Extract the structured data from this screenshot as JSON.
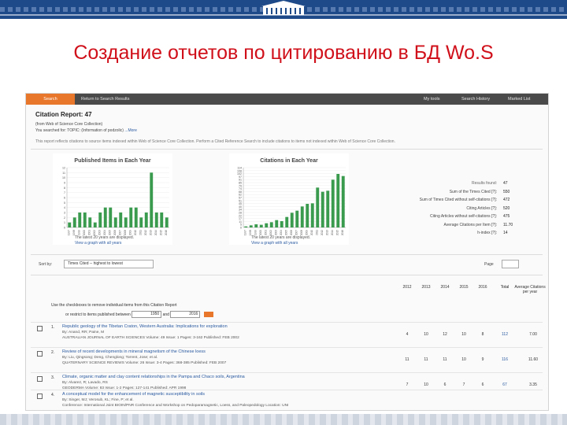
{
  "slide": {
    "title": "Создание отчетов по цитированию в БД Wo.S",
    "banner_color": "#1f4a8a",
    "title_color": "#d0101a"
  },
  "wos": {
    "accent": "#e8762b",
    "nav": {
      "search": "Search",
      "return": "Return to Search Results",
      "my_tools": "My tools",
      "search_history": "Search History",
      "marked_list": "Marked List"
    },
    "report_title": "Citation Report: 47",
    "report_lines": {
      "from": "(from Web of Science Core Collection)",
      "searched_prefix": "You searched for: TOPIC: (Information of podzolic) ",
      "more": "...More",
      "notice": "This report reflects citations to source items indexed within Web of Science Core Collection. Perform a Cited Reference Search to include citations to items not indexed within Web of Science Core Collection."
    },
    "panels": {
      "left": {
        "title": "Published Items in Each Year",
        "note1": "The latest 20 years are displayed.",
        "note2": "View a graph with all years"
      },
      "right": {
        "title": "Citations in Each Year",
        "note1": "The latest 20 years are displayed.",
        "note2": "View a graph with all years"
      }
    },
    "summary": [
      {
        "label": "Results found:",
        "value": "47"
      },
      {
        "label": "Sum of the Times Cited [?]:",
        "value": "550"
      },
      {
        "label": "Sum of Times Cited without self-citations [?]:",
        "value": "472"
      },
      {
        "label": "Citing Articles [?]:",
        "value": "520"
      },
      {
        "label": "Citing Articles without self-citations [?]:",
        "value": "475"
      },
      {
        "label": "Average Citations per Item [?]:",
        "value": "11.70"
      },
      {
        "label": "h-index [?]:",
        "value": "14"
      }
    ],
    "sort": {
      "label": "Sort by:",
      "value": "Times Cited -- highest to lowest",
      "page": "Page"
    },
    "table": {
      "years": [
        "2012",
        "2013",
        "2014",
        "2015",
        "2016"
      ],
      "total_label": "Total",
      "avg_label": "Average Citations per year",
      "help": "Use the checkboxes to remove individual items from this Citation Report",
      "range_prefix": "or restrict to items published between",
      "range_from": "1950",
      "range_and": "and",
      "range_to": "2016"
    },
    "records": [
      {
        "num": "1.",
        "title": "Republic geology of the Tibetan Craton, Western Australia: Implications for exploration",
        "authors": "By: Anand, RR; Paine, M",
        "source": "AUSTRALIAN JOURNAL OF EARTH SCIENCES  Volume: 49  Issue: 1  Pages: 3-162  Published: FEB 2002",
        "cites": [
          "4",
          "10",
          "12",
          "10",
          "8"
        ],
        "total": "112",
        "avg": "7.00"
      },
      {
        "num": "2.",
        "title": "Review of recent developments in mineral magnetism of the Chinese loess",
        "authors": "By: Liu, Qingsong; Deng, Chenglong; Torrent, Jose; et al.",
        "source": "QUATERNARY SCIENCE REVIEWS  Volume: 26  Issue: 3-4  Pages: 368-385  Published: FEB 2007",
        "cites": [
          "11",
          "11",
          "11",
          "10",
          "9"
        ],
        "total": "116",
        "avg": "11.60"
      },
      {
        "num": "3.",
        "title": "Climate, organic matter and clay content relationships in the Pampa and Chaco soils, Argentina",
        "authors": "By: Alvarez, R; Lavado, RS",
        "source": "GEODERMA  Volume: 83  Issue: 1-2  Pages: 127-141  Published: APR 1998",
        "cites": [
          "7",
          "10",
          "6",
          "7",
          "6"
        ],
        "total": "67",
        "avg": "3.35"
      },
      {
        "num": "4.",
        "title": "A conceptual model for the enhancement of magnetic susceptibility in soils",
        "authors": "By: Singer, MJ; Verosub, KL; Fine, P; et al.",
        "source": "Conference: International Joint BIOIN/PNR Conference and Workshop on Pedoparamagnetic, Loess, and Paleopedology  Location: UNI"
      }
    ]
  },
  "chart_data": [
    {
      "type": "bar",
      "title": "Published Items in Each Year",
      "categories": [
        "1997",
        "1998",
        "1999",
        "2000",
        "2001",
        "2002",
        "2003",
        "2004",
        "2005",
        "2006",
        "2007",
        "2008",
        "2009",
        "2010",
        "2011",
        "2012",
        "2013",
        "2014",
        "2015",
        "2016"
      ],
      "values": [
        1,
        2,
        3,
        3,
        2,
        1,
        3,
        4,
        4,
        2,
        3,
        2,
        4,
        4,
        2,
        3,
        11,
        3,
        3,
        2
      ],
      "ylim": [
        0,
        12
      ],
      "yticks": [
        "0",
        "1",
        "2",
        "3",
        "4",
        "5",
        "6",
        "7",
        "8",
        "9",
        "10",
        "11",
        "12"
      ],
      "bar_color": "#3a9a4e"
    },
    {
      "type": "bar",
      "title": "Citations in Each Year",
      "categories": [
        "1997",
        "1998",
        "1999",
        "2000",
        "2001",
        "2002",
        "2003",
        "2004",
        "2005",
        "2006",
        "2007",
        "2008",
        "2009",
        "2010",
        "2011",
        "2012",
        "2013",
        "2014",
        "2015",
        "2016"
      ],
      "values": [
        2,
        4,
        6,
        5,
        8,
        10,
        14,
        12,
        20,
        28,
        32,
        40,
        45,
        46,
        76,
        68,
        70,
        91,
        102,
        98
      ],
      "ylim": [
        0,
        114
      ],
      "yticks": [
        "0",
        "5",
        "11",
        "17",
        "22",
        "28",
        "34",
        "40",
        "45",
        "51",
        "57",
        "62",
        "68",
        "74",
        "79",
        "85",
        "91",
        "97",
        "102",
        "108",
        "114"
      ],
      "bar_color": "#3a9a4e"
    }
  ]
}
